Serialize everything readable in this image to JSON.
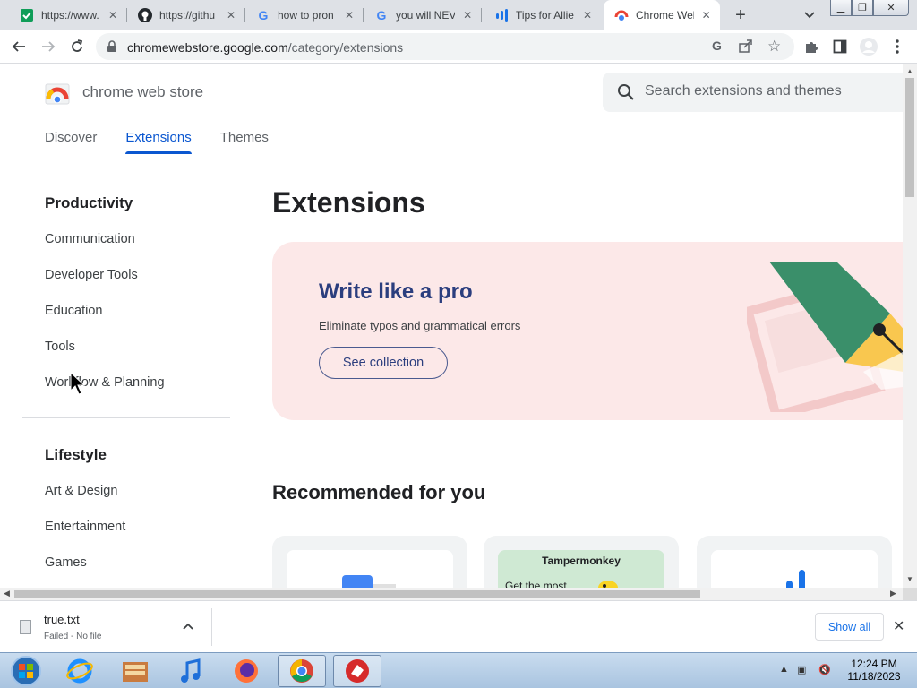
{
  "browser": {
    "tabs": [
      {
        "title": "https://www.",
        "icon": "sheets-favicon-icon"
      },
      {
        "title": "https://githu",
        "icon": "github-favicon-icon"
      },
      {
        "title": "how to pron",
        "icon": "google-favicon-icon"
      },
      {
        "title": "you will NEV",
        "icon": "google-favicon-icon"
      },
      {
        "title": "Tips for Allie",
        "icon": "audio-wave-favicon-icon"
      },
      {
        "title": "Chrome Web",
        "icon": "webstore-favicon-icon",
        "active": true
      }
    ],
    "url": {
      "host": "chromewebstore.google.com",
      "path": "/category/extensions"
    }
  },
  "store": {
    "brand": "chrome web store",
    "search_placeholder": "Search extensions and themes",
    "nav": [
      "Discover",
      "Extensions",
      "Themes"
    ],
    "active_nav": "Extensions"
  },
  "sidebar": {
    "sections": [
      {
        "title": "Productivity",
        "items": [
          "Communication",
          "Developer Tools",
          "Education",
          "Tools",
          "Workflow & Planning"
        ]
      },
      {
        "title": "Lifestyle",
        "items": [
          "Art & Design",
          "Entertainment",
          "Games"
        ]
      }
    ]
  },
  "main": {
    "title": "Extensions",
    "banner": {
      "title": "Write like a pro",
      "subtitle": "Eliminate typos and grammatical errors",
      "button": "See collection"
    },
    "recommended_title": "Recommended for you",
    "cards": [
      {
        "name": "",
        "icon": "google-docs-offline-icon"
      },
      {
        "name": "Tampermonkey",
        "subtitle": "Get the most"
      },
      {
        "name": "",
        "icon": "audio-wave-icon"
      }
    ]
  },
  "download": {
    "filename": "true.txt",
    "status": "Failed - No file",
    "show_all": "Show all"
  },
  "taskbar": {
    "time": "12:24 PM",
    "date": "11/18/2023"
  },
  "colors": {
    "accent": "#0b57d0",
    "banner_bg": "#fce8e8",
    "banner_title": "#2b3e7e"
  }
}
